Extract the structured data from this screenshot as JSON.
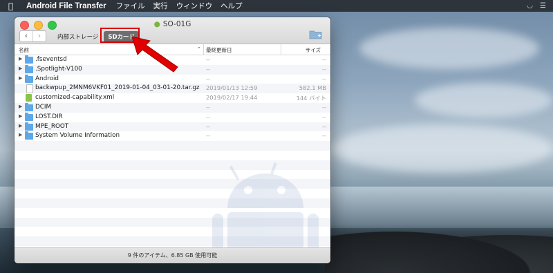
{
  "menubar": {
    "app_name": "Android File Transfer",
    "items": [
      "ファイル",
      "実行",
      "ウィンドウ",
      "ヘルプ"
    ]
  },
  "window": {
    "title": "SO-01G",
    "storage_tabs": {
      "internal": "内部ストレージ",
      "sd": "SDカード"
    },
    "columns": {
      "name": "名前",
      "modified": "最終更新日",
      "size": "サイズ"
    },
    "files": [
      {
        "name": ".fseventsd",
        "type": "folder",
        "date": "--",
        "size": "--"
      },
      {
        "name": ".Spotlight-V100",
        "type": "folder",
        "date": "--",
        "size": "--"
      },
      {
        "name": "Android",
        "type": "folder",
        "date": "--",
        "size": "--"
      },
      {
        "name": "backwpup_2MNM6VKF01_2019-01-04_03-01-20.tar.gz",
        "type": "file",
        "date": "2019/01/13 12:59",
        "size": "582.1 MB"
      },
      {
        "name": "customized-capability.xml",
        "type": "xml",
        "date": "2019/02/17 19:44",
        "size": "144 バイト"
      },
      {
        "name": "DCIM",
        "type": "folder",
        "date": "--",
        "size": "--"
      },
      {
        "name": "LOST.DIR",
        "type": "folder",
        "date": "--",
        "size": "--"
      },
      {
        "name": "MPE_ROOT",
        "type": "folder",
        "date": "--",
        "size": "--"
      },
      {
        "name": "System Volume Information",
        "type": "folder",
        "date": "--",
        "size": "--"
      }
    ],
    "status": "9 件のアイテム、6.85 GB 使用可能"
  },
  "colors": {
    "highlight": "#d60000",
    "arrow": "#e00000",
    "folder": "#5fa8e8"
  }
}
